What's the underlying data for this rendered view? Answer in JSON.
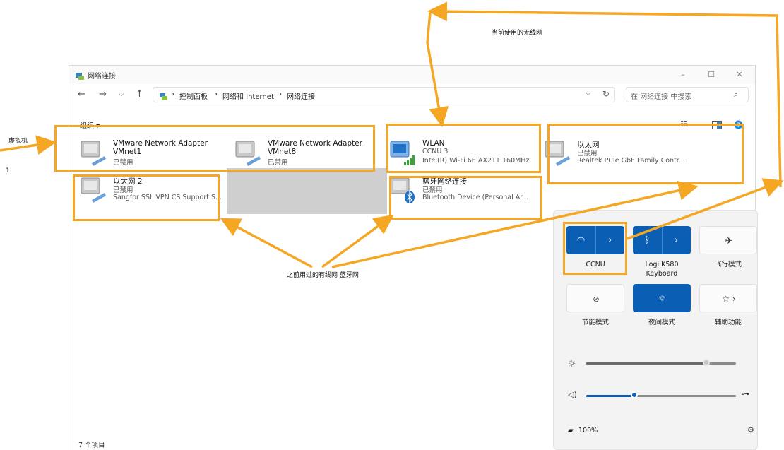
{
  "annotations": {
    "current_wifi": "当前使用的无线网",
    "virtual_machine": "虚拟机",
    "left_edge": "1",
    "previous_wired_bt": "之前用过的有线网 蓝牙网",
    "accent_color": "#f5a623"
  },
  "window": {
    "title": "网络连接",
    "controls": [
      "–",
      "☐",
      "✕"
    ]
  },
  "address": {
    "breadcrumbs": [
      "控制面板",
      "网络和 Internet",
      "网络连接"
    ],
    "separator": "›",
    "search_placeholder": "在 网络连接 中搜索"
  },
  "toolbar": {
    "organize": "组织 ▾"
  },
  "connections": [
    {
      "name": "VMware Network Adapter",
      "line2": "VMnet1",
      "status": "已禁用",
      "icon": "network-adapter-icon"
    },
    {
      "name": "VMware Network Adapter",
      "line2": "VMnet8",
      "status": "已禁用",
      "icon": "network-adapter-icon"
    },
    {
      "name": "WLAN",
      "line2": "CCNU 3",
      "status": "Intel(R) Wi-Fi 6E AX211 160MHz",
      "icon": "wifi-adapter-icon"
    },
    {
      "name": "以太网",
      "line2": "已禁用",
      "status": "Realtek PCIe GbE Family Contr...",
      "icon": "network-adapter-icon"
    },
    {
      "name": "以太网 2",
      "line2": "已禁用",
      "status": "Sangfor SSL VPN CS Support S...",
      "icon": "network-adapter-icon"
    },
    {
      "name": "蓝牙网络连接",
      "line2": "已禁用",
      "status": "Bluetooth Device (Personal Ar...",
      "icon": "bluetooth-adapter-icon"
    }
  ],
  "status_bar": "7 个项目",
  "quick_settings": {
    "wifi_label": "CCNU",
    "bluetooth_label": "Logi K580\nKeyboard",
    "airplane_label": "飞行模式",
    "battery_saver_label": "节能模式",
    "night_light_label": "夜间模式",
    "accessibility_label": "辅助功能",
    "brightness_level": 0.8,
    "volume_level": 0.32,
    "battery": "100%",
    "accent": "#0a5fb4"
  }
}
